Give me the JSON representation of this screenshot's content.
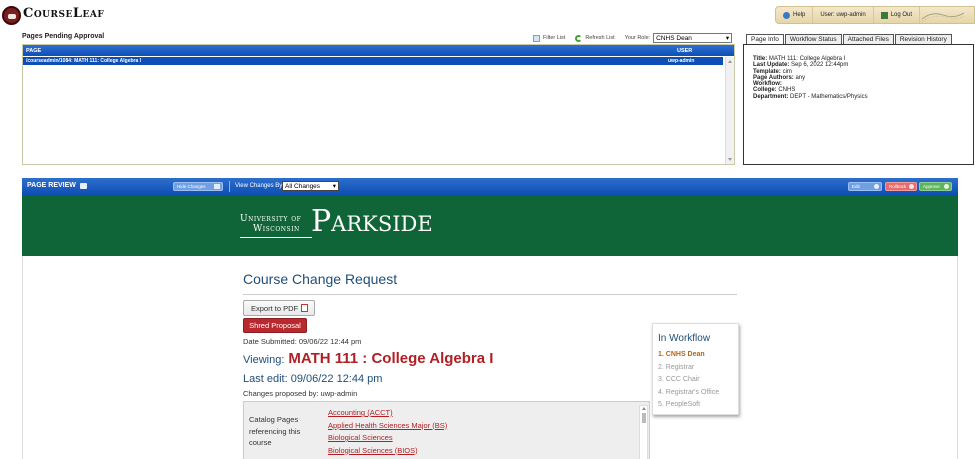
{
  "header": {
    "app_name": "CourseLeaf",
    "help_label": "Help",
    "user_label": "User: uwp-admin",
    "logout_label": "Log Out"
  },
  "pending": {
    "title": "Pages Pending Approval",
    "filter_label": "Filter List",
    "refresh_label": "Refresh List",
    "role_label": "Your Role:",
    "role_value": "CNHS Dean",
    "columns": [
      "PAGE",
      "USER"
    ],
    "rows": [
      {
        "page": "/courseadmin/1084: MATH 111: College Algebra I",
        "user": "uwp-admin"
      }
    ]
  },
  "info_tabs": [
    "Page Info",
    "Workflow Status",
    "Attached Files",
    "Revision History"
  ],
  "page_info": [
    {
      "label": "Title:",
      "value": "MATH 111: College Algebra I"
    },
    {
      "label": "Last Update:",
      "value": "Sep 6, 2022 12:44pm"
    },
    {
      "label": "Template:",
      "value": "cim"
    },
    {
      "label": "Page Authors:",
      "value": "any"
    },
    {
      "label": "Workflow:",
      "value": ""
    },
    {
      "label": "College:",
      "value": "CNHS"
    },
    {
      "label": "Department:",
      "value": "DEPT - Mathematics/Physics"
    }
  ],
  "review": {
    "title": "PAGE REVIEW",
    "hide_changes_label": "Hide Changes",
    "view_changes_label": "View Changes By:",
    "view_changes_value": "All Changes",
    "edit_label": "Edit",
    "rollback_label": "Rollback",
    "approve_label": "Approve"
  },
  "banner": {
    "line1": "University of",
    "line2": "Wisconsin",
    "name": "Parkside"
  },
  "course": {
    "page_title": "Course Change Request",
    "export_label": "Export to PDF",
    "shred_label": "Shred Proposal",
    "date_submitted": "Date Submitted: 09/06/22 12:44 pm",
    "viewing_label": "Viewing:",
    "viewing_course": "MATH 111 : College Algebra I",
    "last_edit": "Last edit: 09/06/22 12:44 pm",
    "changes_by": "Changes proposed by: uwp-admin",
    "catalog_label": "Catalog Pages referencing this course",
    "catalog_links": [
      "Accounting (ACCT)",
      "Applied Health Sciences Major (BS)",
      "Biological Sciences",
      "Biological Sciences (BIOS)"
    ]
  },
  "workflow": {
    "title": "In Workflow",
    "steps": [
      "1. CNHS Dean",
      "2. Registrar",
      "3. CCC Chair",
      "4. Registrar's Office",
      "5. PeopleSoft"
    ],
    "current_index": 0
  },
  "colors": {
    "header_blue": "#0d4fb6",
    "banner_green": "#0f6537",
    "accent_red": "#b11f24",
    "title_blue": "#1f4e79"
  }
}
